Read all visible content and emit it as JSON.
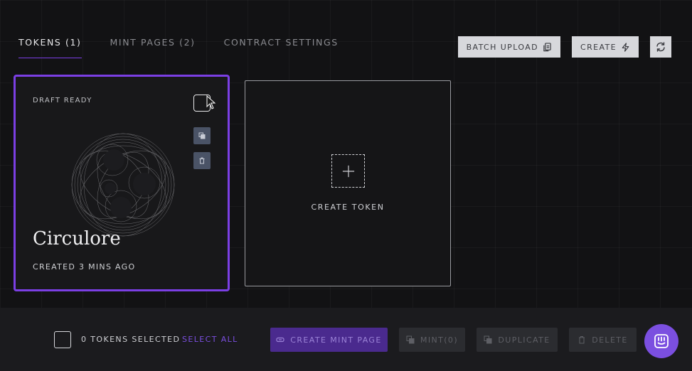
{
  "tabs": [
    {
      "label": "TOKENS (1)"
    },
    {
      "label": "MINT PAGES (2)"
    },
    {
      "label": "CONTRACT SETTINGS"
    }
  ],
  "actions": {
    "batch_upload": "BATCH UPLOAD",
    "create": "CREATE"
  },
  "token_card": {
    "status": "DRAFT READY",
    "title": "Circulore",
    "created": "CREATED 3 MINS AGO"
  },
  "create_card": {
    "label": "CREATE TOKEN"
  },
  "bottom_bar": {
    "selected_count": "0 TOKENS SELECTED",
    "select_all": "SELECT ALL",
    "create_mint_page": "CREATE MINT PAGE",
    "mint": "MINT(0)",
    "duplicate": "DUPLICATE",
    "delete": "DELETE"
  },
  "colors": {
    "accent": "#7b3fe4",
    "background": "#141416",
    "bottom_bar": "#1b1b1e"
  },
  "icons": [
    "batch-upload-icon",
    "lightning-icon",
    "refresh-icon",
    "duplicate-icon",
    "trash-icon",
    "plus-icon",
    "link-icon",
    "chat-icon"
  ]
}
